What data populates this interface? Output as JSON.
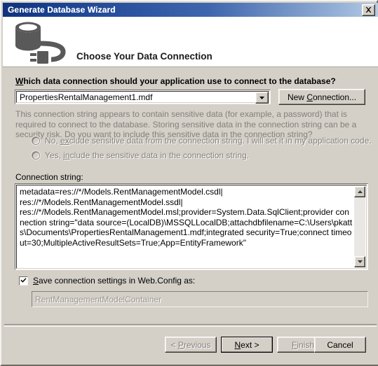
{
  "window": {
    "title": "Generate Database Wizard",
    "close_label": "x",
    "close_icon": "close-icon"
  },
  "header": {
    "icon": "database-connection-icon",
    "title": "Choose Your Data Connection"
  },
  "form": {
    "question_label_pre": "W",
    "question_label_post": "hich data connection should your application use to connect to the database?",
    "connection_combo": {
      "value": "PropertiesRentalManagement1.mdf",
      "arrow_icon": "chevron-down-icon"
    },
    "new_connection_button_pre": "New ",
    "new_connection_button_key": "C",
    "new_connection_button_post": "onnection...",
    "sensitive_notice": "This connection string appears to contain sensitive data (for example, a password) that is required to connect to the database. Storing sensitive data in the connection string can be a security risk. Do you want to include this sensitive data in the connection string?",
    "radios": [
      {
        "name": "exclude-sensitive-data",
        "pre": "No, ",
        "key": "ex",
        "post": "clude sensitive data from the connection string. I will set it in my application code.",
        "selected": false,
        "disabled": true
      },
      {
        "name": "include-sensitive-data",
        "pre": "Yes, ",
        "key": "in",
        "post": "clude the sensitive data in the connection string.",
        "selected": false,
        "disabled": true
      }
    ],
    "connection_string_label": "Connection string:",
    "connection_string_value": "metadata=res://*/Models.RentManagementModel.csdl|\nres://*/Models.RentManagementModel.ssdl|\nres://*/Models.RentManagementModel.msl;provider=System.Data.SqlClient;provider connection string=\"data source=(LocalDB)\\MSSQLLocalDB;attachdbfilename=C:\\Users\\pkatts\\Documents\\PropertiesRentalManagement1.mdf;integrated security=True;connect timeout=30;MultipleActiveResultSets=True;App=EntityFramework\"",
    "scrollbar": {
      "up_icon": "scroll-up-arrow-icon",
      "down_icon": "scroll-down-arrow-icon"
    },
    "save_checkbox": {
      "checked": true,
      "pre": "",
      "key": "S",
      "post": "ave connection settings in Web.Config as:",
      "check_icon": "checkmark-icon"
    },
    "container_name_value": "RentManagementModelContainer"
  },
  "footer": {
    "buttons": [
      {
        "name": "previous-button",
        "pre": "< ",
        "key": "P",
        "post": "revious",
        "disabled": true,
        "focused": false
      },
      {
        "name": "next-button",
        "pre": "",
        "key": "N",
        "post": "ext >",
        "disabled": false,
        "focused": true
      },
      {
        "name": "finish-button",
        "pre": "",
        "key": "F",
        "post": "inish",
        "disabled": true,
        "focused": false
      },
      {
        "name": "cancel-button",
        "pre": "",
        "key": "",
        "post": "Cancel",
        "disabled": false,
        "focused": false
      }
    ]
  },
  "colors": {
    "dialog_face": "#d4d0c8",
    "titlebar_start": "#10327c",
    "titlebar_end": "#b9cbe4",
    "header_band": "#ffffff",
    "disabled_text": "#84807a",
    "icon_gray": "#595959"
  }
}
